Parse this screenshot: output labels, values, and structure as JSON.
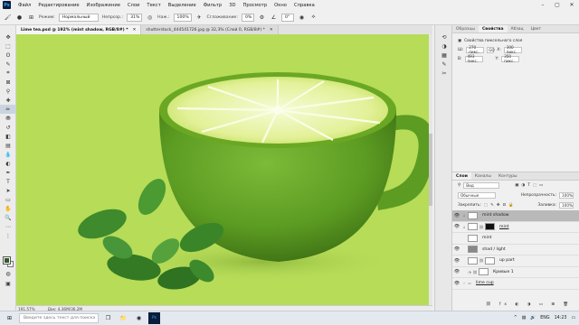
{
  "app": {
    "logo": "Ps"
  },
  "menu": [
    "Файл",
    "Редактирование",
    "Изображение",
    "Слои",
    "Текст",
    "Выделение",
    "Фильтр",
    "3D",
    "Просмотр",
    "Окно",
    "Справка"
  ],
  "options": {
    "mode_label": "Режим:",
    "mode_value": "Нормальный",
    "opacity_label": "Непрозр.:",
    "opacity_value": "31%",
    "pressure_label": "Наж.:",
    "pressure_value": "100%",
    "smoothing_label": "Сглаживание:",
    "smoothing_value": "0%",
    "angle_value": "0°"
  },
  "tabs": [
    "Lime tea.psd @ 192% (mint shadow, RGB/8#) *",
    "shutterstock_444541726.jpg @ 32,3% (Слой 0, RGB/8#) *"
  ],
  "status": {
    "zoom": "191,57%",
    "doc": "Док: 4,36M/36,2M"
  },
  "props": {
    "tabs": [
      "Образцы",
      "Свойства",
      "Абзац",
      "Цвет"
    ],
    "title": "Свойства пиксельного слоя",
    "w_label": "Ш:",
    "w_value": "270 пикс.",
    "h_label": "В:",
    "h_value": "493 пикс.",
    "x_label": "X:",
    "x_value": "300 пикс.",
    "y_label": "Y:",
    "y_value": "350 пикс.",
    "link_label": "GO"
  },
  "layers": {
    "tabs": [
      "Слои",
      "Каналы",
      "Контуры"
    ],
    "filter_label": "Вид",
    "blend": "Обычные",
    "opacity_label": "Непрозрачность:",
    "opacity_value": "100%",
    "lock_label": "Закрепить:",
    "fill_label": "Заливка:",
    "fill_value": "100%",
    "items": [
      {
        "name": "mint shadow",
        "selected": true,
        "visible": true,
        "thumb": "white"
      },
      {
        "name": "mint",
        "selected": false,
        "visible": true,
        "thumb": "dark",
        "mask": true
      },
      {
        "name": "mint",
        "selected": false,
        "visible": false,
        "thumb": "white"
      },
      {
        "name": "shad / light",
        "selected": false,
        "visible": true,
        "thumb": "gray"
      },
      {
        "name": "up part",
        "selected": false,
        "visible": true,
        "thumb": "white",
        "mask": true
      },
      {
        "name": "Кривые 1",
        "selected": false,
        "visible": true,
        "thumb": "white",
        "mask": true
      },
      {
        "name": "lime cup",
        "selected": false,
        "visible": true,
        "thumb": "folder"
      }
    ]
  },
  "taskbar": {
    "search_placeholder": "Введите здесь текст для поиска",
    "lang": "ENG",
    "time": "14:23"
  },
  "colors": {
    "canvas_bg": "#b6dc58",
    "lime": "#5c9c22",
    "lime_flesh": "#eef7b4",
    "mint": "#3e8a2c",
    "fg": "#2e5b22"
  },
  "icons": [
    "move-icon",
    "marquee-icon",
    "lasso-icon",
    "quick-select-icon",
    "crop-icon",
    "eyedropper-icon",
    "healing-icon",
    "brush-icon",
    "stamp-icon",
    "history-brush-icon",
    "eraser-icon",
    "gradient-icon",
    "blur-icon",
    "dodge-icon",
    "pen-icon",
    "type-icon",
    "path-select-icon",
    "shape-icon",
    "hand-icon",
    "zoom-icon"
  ]
}
